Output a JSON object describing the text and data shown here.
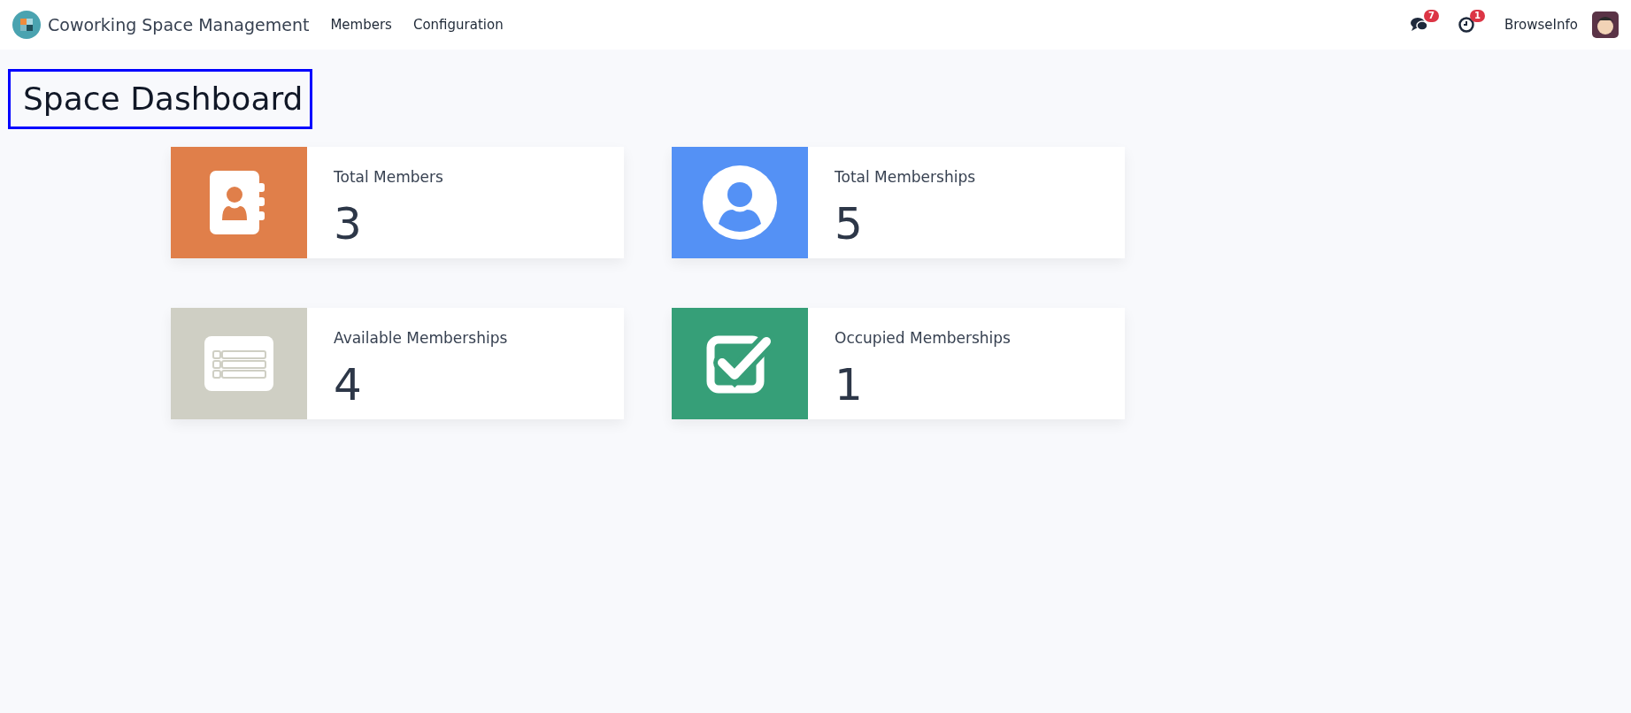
{
  "navbar": {
    "app_title": "Coworking Space Management",
    "menu": [
      "Members",
      "Configuration"
    ],
    "messages_badge": "7",
    "activities_badge": "1",
    "user": "BrowseInfo"
  },
  "page_title": "Space Dashboard",
  "cards": [
    {
      "kind": "contacts",
      "label": "Total Members",
      "value": "3",
      "color": "#e07f4a"
    },
    {
      "kind": "user",
      "label": "Total Memberships",
      "value": "5",
      "color": "#5491f5"
    },
    {
      "kind": "list",
      "label": "Available Memberships",
      "value": "4",
      "color": "#cfcfc4"
    },
    {
      "kind": "check",
      "label": "Occupied Memberships",
      "value": "1",
      "color": "#369f78"
    }
  ]
}
